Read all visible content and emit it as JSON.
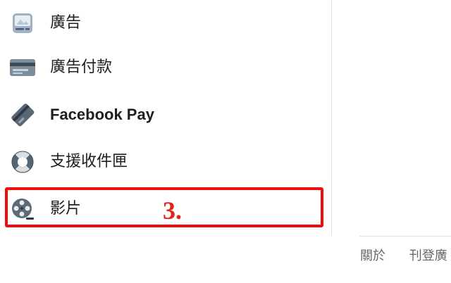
{
  "sidebar": {
    "items": [
      {
        "label": "廣告",
        "icon": "ads-icon"
      },
      {
        "label": "廣告付款",
        "icon": "credit-card-icon"
      },
      {
        "label": "Facebook Pay",
        "icon": "facebook-pay-icon"
      },
      {
        "label": "支援收件匣",
        "icon": "lifebuoy-icon"
      },
      {
        "label": "影片",
        "icon": "film-reel-icon"
      }
    ]
  },
  "annotation": {
    "text": "3."
  },
  "footer": {
    "links": [
      "關於",
      "刊登廣"
    ]
  },
  "colors": {
    "highlight": "#f20d0d",
    "text": "#1c1e21",
    "footer_text": "#65676b"
  }
}
